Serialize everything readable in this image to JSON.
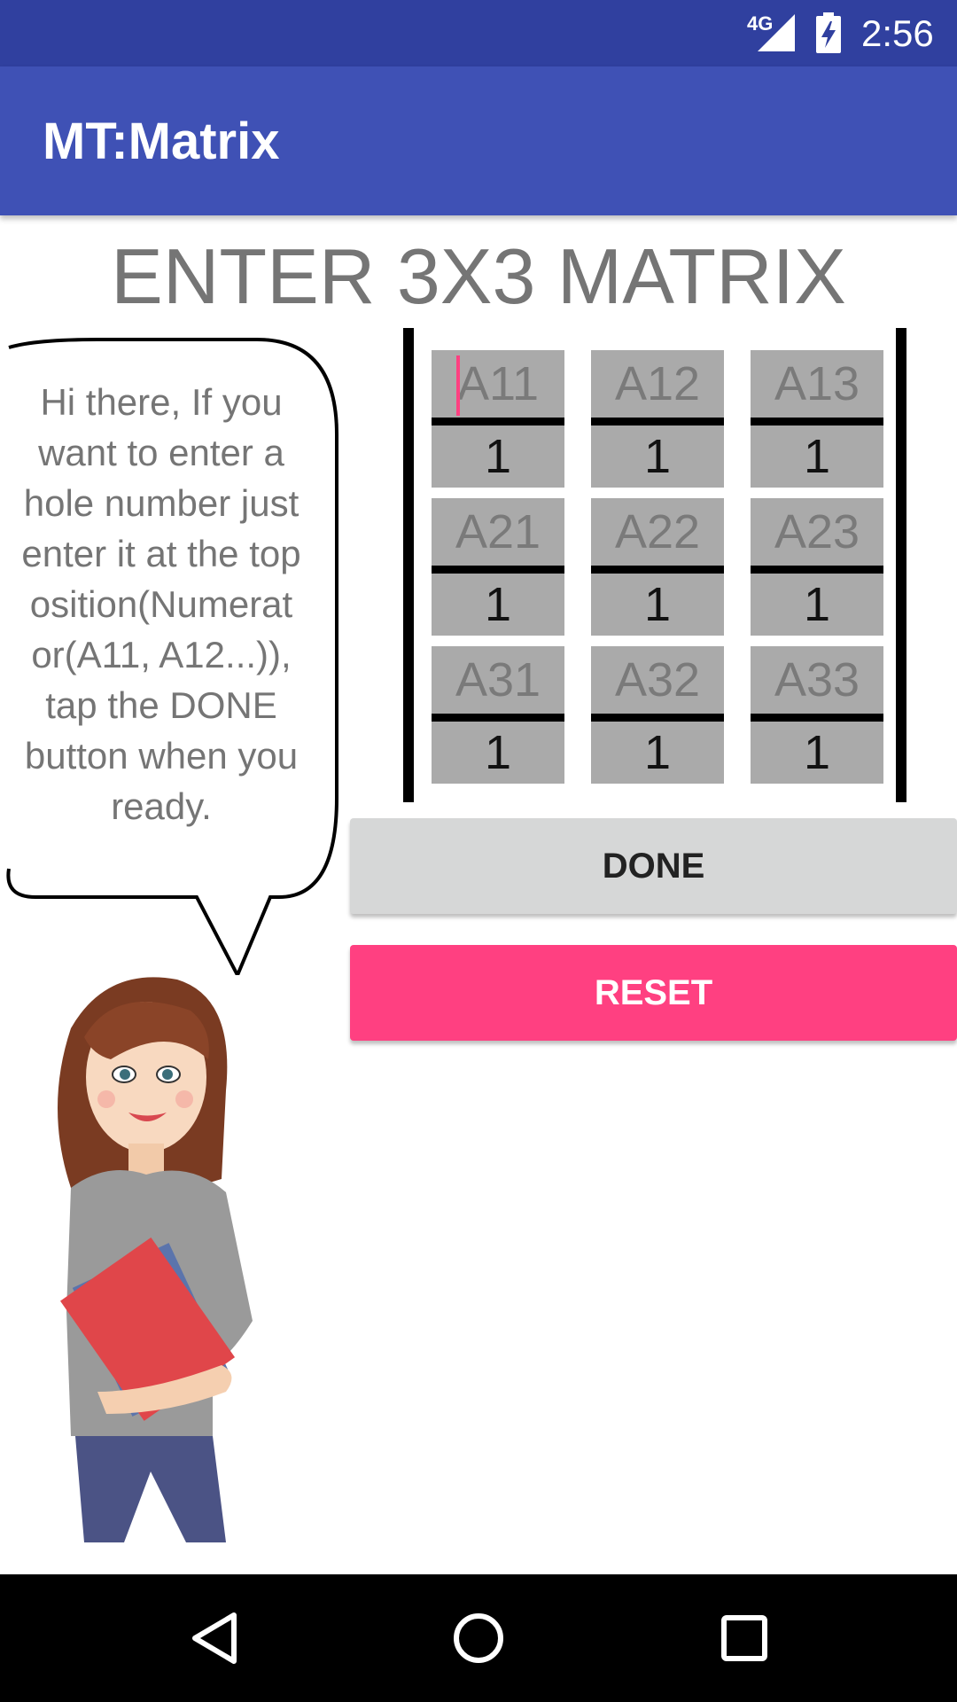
{
  "status_bar": {
    "network": "4G",
    "time": "2:56",
    "icons": [
      "signal-icon",
      "battery-charging-icon"
    ]
  },
  "app_bar": {
    "title": "MT:Matrix"
  },
  "main": {
    "heading": "ENTER 3X3 MATRIX",
    "speech_bubble": {
      "lines": [
        "Hi there, If you",
        "want to enter a",
        "hole number just",
        "enter it at the top",
        "osition(Numerat",
        "or(A11, A12...)),",
        "tap the DONE",
        "button when you",
        "ready."
      ]
    },
    "matrix": {
      "cells": [
        {
          "numerator_placeholder": "A11",
          "denominator": "1"
        },
        {
          "numerator_placeholder": "A12",
          "denominator": "1"
        },
        {
          "numerator_placeholder": "A13",
          "denominator": "1"
        },
        {
          "numerator_placeholder": "A21",
          "denominator": "1"
        },
        {
          "numerator_placeholder": "A22",
          "denominator": "1"
        },
        {
          "numerator_placeholder": "A23",
          "denominator": "1"
        },
        {
          "numerator_placeholder": "A31",
          "denominator": "1"
        },
        {
          "numerator_placeholder": "A32",
          "denominator": "1"
        },
        {
          "numerator_placeholder": "A33",
          "denominator": "1"
        }
      ]
    },
    "done_label": "DONE",
    "reset_label": "RESET"
  },
  "colors": {
    "status_bar": "#30409f",
    "app_bar": "#3f51b5",
    "accent": "#ff4081",
    "cell": "#aaaaaa",
    "done_button": "#d6d7d7"
  },
  "nav_bar": {
    "icons": [
      "back-icon",
      "home-icon",
      "recents-icon"
    ]
  }
}
